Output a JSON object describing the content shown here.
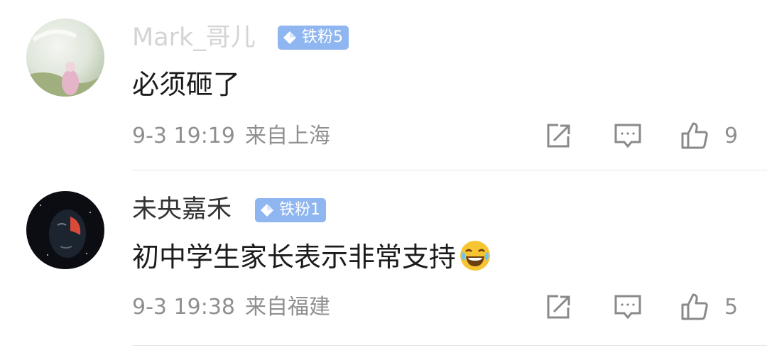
{
  "comments": [
    {
      "username": "Mark_哥儿",
      "badge": "铁粉5",
      "text": "必须砸了",
      "time": "9-3 19:19",
      "location": "来自上海",
      "likes": "9",
      "avatar_icon": "avatar-photo-pink-figure",
      "username_color": "#d4d4d4"
    },
    {
      "username": "未央嘉禾",
      "badge": "铁粉1",
      "text": "初中学生家长表示非常支持",
      "emoji": "laughing-tears-emoji",
      "time": "9-3 19:38",
      "location": "来自福建",
      "likes": "5",
      "avatar_icon": "avatar-photo-dark-face",
      "username_color": "#333333"
    }
  ],
  "icons": {
    "badge": "diamond-icon",
    "share": "share-icon",
    "reply": "comment-icon",
    "like": "thumbs-up-icon"
  },
  "colors": {
    "badge_bg": "#8fb6f0",
    "meta_text": "#8f8f8f",
    "divider": "#e6e6e6"
  }
}
